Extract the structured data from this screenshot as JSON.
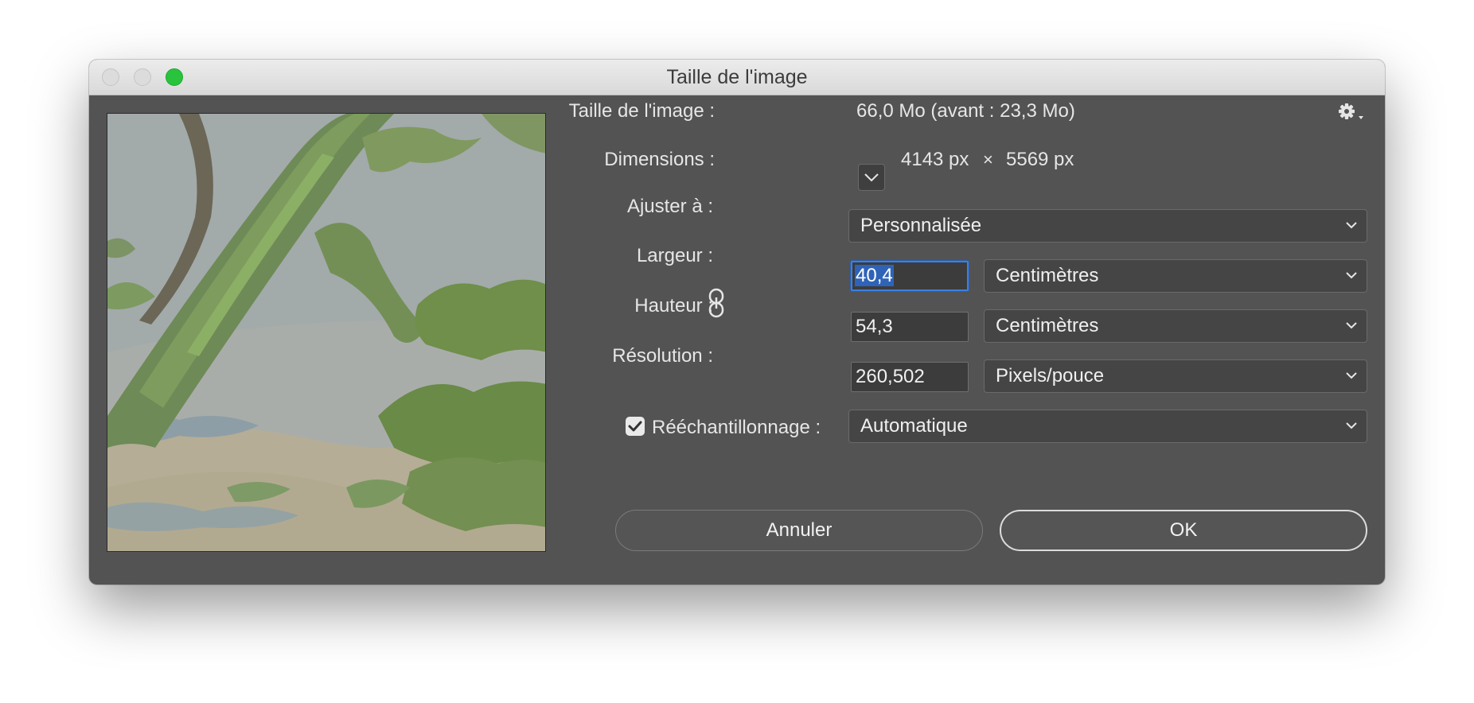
{
  "window": {
    "title": "Taille de l'image"
  },
  "info": {
    "size_label": "Taille de l'image :",
    "size_value": "66,0 Mo (avant : 23,3 Mo)",
    "dimensions_label": "Dimensions :",
    "width_px": "4143 px",
    "times": "×",
    "height_px": "5569 px"
  },
  "fit": {
    "label": "Ajuster à :",
    "value": "Personnalisée"
  },
  "width": {
    "label": "Largeur :",
    "value": "40,4",
    "unit": "Centimètres"
  },
  "height": {
    "label": "Hauteur :",
    "value": "54,3",
    "unit": "Centimètres"
  },
  "resolution": {
    "label": "Résolution :",
    "value": "260,502",
    "unit": "Pixels/pouce"
  },
  "resample": {
    "label": "Rééchantillonnage :",
    "value": "Automatique",
    "checked": true
  },
  "buttons": {
    "cancel": "Annuler",
    "ok": "OK"
  },
  "icons": {
    "settings": "gear-icon",
    "link": "chain-link-icon",
    "chevron": "chevron-down-icon",
    "check": "checkmark-icon"
  },
  "colors": {
    "dialog_bg": "#535353",
    "focus": "#3d7fe0",
    "selection": "#2f63b8",
    "zoom_button": "#29c33e"
  }
}
